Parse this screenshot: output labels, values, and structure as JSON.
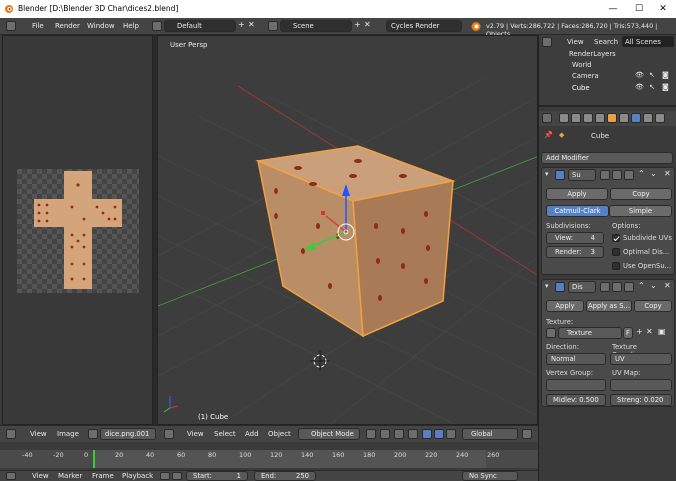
{
  "window": {
    "title": "Blender  [D:\\Blender 3D Char\\dices2.blend]",
    "minimize": "—",
    "maximize": "☐",
    "close": "✕"
  },
  "infobar": {
    "menus": [
      "File",
      "Render",
      "Window",
      "Help"
    ],
    "layout": "Default",
    "scene": "Scene",
    "engine": "Cycles Render",
    "stats": "v2.79 | Verts:286,722 | Faces:286,720 | Tris:573,440 | Objects"
  },
  "viewport": {
    "view_label": "User Persp",
    "object_label": "(1) Cube"
  },
  "outliner": {
    "tabs": [
      "View",
      "Search",
      "All Scenes"
    ],
    "items": [
      "RenderLayers",
      "World",
      "Camera",
      "Cube"
    ]
  },
  "properties": {
    "object_name": "Cube",
    "add_modifier": "Add Modifier",
    "subsurf": {
      "name": "Su",
      "apply": "Apply",
      "copy": "Copy",
      "tab_catmull": "Catmull-Clark",
      "tab_simple": "Simple",
      "subdivisions_label": "Subdivisions:",
      "options_label": "Options:",
      "view_label": "View:",
      "view_value": "4",
      "render_label": "Render:",
      "render_value": "3",
      "opt_uvs": "Subdivide UVs",
      "opt_display": "Optimal Dis...",
      "opt_opensubdiv": "Use OpenSu..."
    },
    "displace": {
      "name": "Dis",
      "apply": "Apply",
      "apply_shape": "Apply as S...",
      "copy": "Copy",
      "texture_label": "Texture:",
      "texture_value": "Texture",
      "texture_flag": "F",
      "direction_label": "Direction:",
      "coords_label": "Texture Coordina...",
      "direction_value": "Normal",
      "coords_value": "UV",
      "vgroup_label": "Vertex Group:",
      "uvmap_label": "UV Map:",
      "midlevel": "Midlev: 0.500",
      "strength": "Streng: 0.020"
    }
  },
  "uv_header": {
    "menus": [
      "View",
      "Image"
    ],
    "image": "dice.png.001"
  },
  "view3d_header": {
    "menus": [
      "View",
      "Select",
      "Add",
      "Object"
    ],
    "mode": "Object Mode",
    "orientation": "Global"
  },
  "timeline": {
    "ticks": [
      "-40",
      "-20",
      "0",
      "20",
      "40",
      "60",
      "80",
      "100",
      "120",
      "140",
      "160",
      "180",
      "200",
      "220",
      "240",
      "260"
    ],
    "menus": [
      "View",
      "Marker",
      "Frame",
      "Playback"
    ],
    "start": "Start:",
    "start_val": "1",
    "end": "End:",
    "end_val": "250",
    "sync": "No Sync"
  },
  "colors": {
    "accent": "#5680c2",
    "outline": "#f2a041",
    "die_face": "#c89a72",
    "pip": "#9a2a1a"
  }
}
